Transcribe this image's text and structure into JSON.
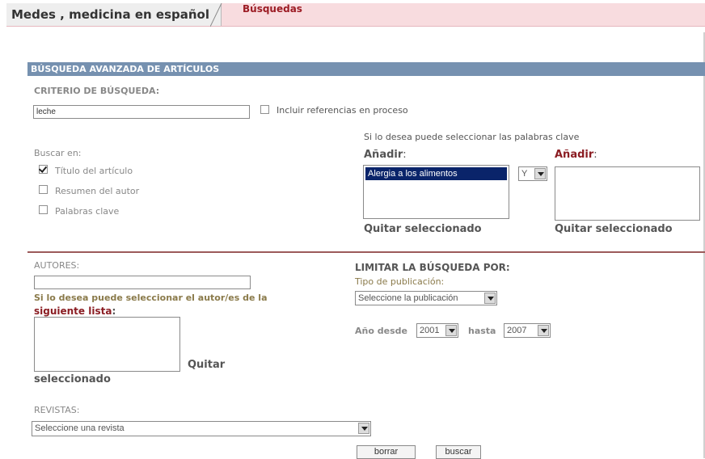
{
  "tabs": {
    "site": "Medes , medicina en español",
    "current": "Búsquedas"
  },
  "section_title": "BÚSQUEDA AVANZADA DE ARTÍCULOS",
  "criteria": {
    "heading": "CRITERIO DE BÚSQUEDA:",
    "search_value": "leche",
    "include_refs_label": "Incluir referencias en proceso",
    "include_refs_checked": false
  },
  "search_in": {
    "heading": "Buscar en:",
    "options": [
      {
        "label": "Título del artículo",
        "checked": true
      },
      {
        "label": "Resumen del autor",
        "checked": false
      },
      {
        "label": "Palabras clave",
        "checked": false
      }
    ]
  },
  "keywords": {
    "hint": "Si lo desea puede seleccionar las palabras clave",
    "add_left": "Añadir",
    "add_right": "Añadir",
    "colon": ":",
    "selected_items": [
      "Alergia a los alimentos"
    ],
    "operator": "Y",
    "remove_left": "Quitar seleccionado",
    "remove_right": "Quitar seleccionado"
  },
  "authors": {
    "heading": "AUTORES:",
    "value": "",
    "hint_line1": "Si lo desea puede seleccionar el autor/es de la",
    "hint_line2": "siguiente lista",
    "colon": ":",
    "remove_part1": "Quitar",
    "remove_part2": "seleccionado"
  },
  "limit": {
    "heading": "LIMITAR LA BÚSQUEDA POR:",
    "pub_type_label": "Tipo de publicación:",
    "pub_type_value": "Seleccione la publicación",
    "year_from_label": "Año desde",
    "year_from": "2001",
    "year_to_label": "hasta",
    "year_to": "2007"
  },
  "journals": {
    "heading": "REVISTAS:",
    "value": "Seleccione una revista"
  },
  "buttons": {
    "clear": "borrar",
    "search": "buscar"
  },
  "colors": {
    "header_bg": "#7691b0",
    "tab_bg": "#f8dcdf",
    "accent_red": "#8b1d23",
    "divider": "#9c5a5a"
  }
}
